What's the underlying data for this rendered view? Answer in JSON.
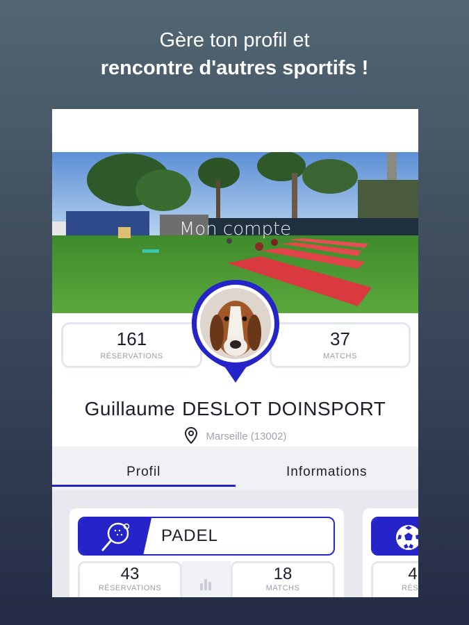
{
  "headline": {
    "line1": "Gère ton profil et",
    "line2": "rencontre d'autres sportifs !"
  },
  "header": {
    "title": "Mon compte"
  },
  "stats": {
    "reservations": {
      "value": "161",
      "label": "RÉSERVATIONS"
    },
    "matchs": {
      "value": "37",
      "label": "MATCHS"
    }
  },
  "user": {
    "first_name": "Guillaume",
    "last_name": "DESLOT DOINSPORT",
    "location": "Marseille (13002)"
  },
  "tabs": [
    {
      "label": "Profil",
      "active": true
    },
    {
      "label": "Informations",
      "active": false
    }
  ],
  "sports": [
    {
      "name": "PADEL",
      "icon": "padel-racket-icon",
      "reservations": {
        "value": "43",
        "label": "RÉSERVATIONS"
      },
      "matchs": {
        "value": "18",
        "label": "MATCHS"
      }
    },
    {
      "name": "",
      "icon": "football-icon",
      "reservations": {
        "value": "4",
        "label": "RÉSE"
      }
    }
  ],
  "colors": {
    "accent": "#2424c8",
    "text": "#1d1d2b",
    "muted": "#9a9da8"
  }
}
